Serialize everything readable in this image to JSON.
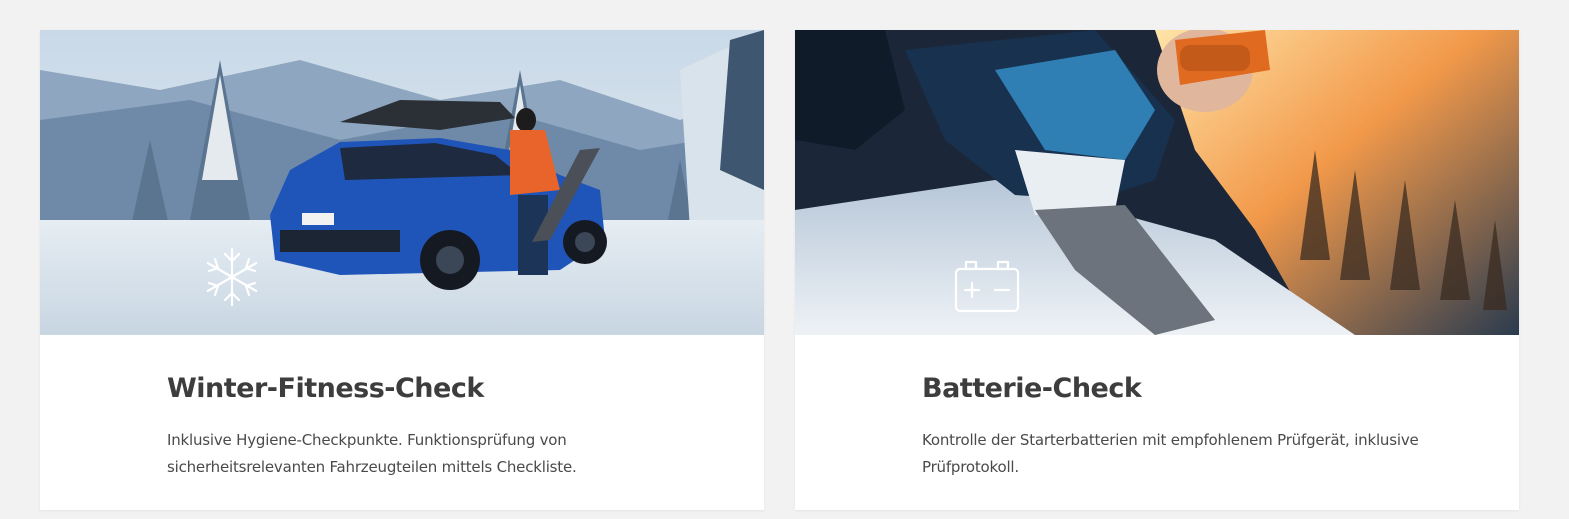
{
  "cards": [
    {
      "title": "Winter-Fitness-Check",
      "description": "Inklusive Hygiene-Checkpunkte. Funktionsprüfung von sicherheitsrelevanten Fahrzeugteilen mittels Checkliste.",
      "image": "snowy-mountain-car-scene",
      "icon": "snowflake-icon"
    },
    {
      "title": "Batterie-Check",
      "description": "Kontrolle der Starterbatterien mit empfohlenem Prüfgerät, inklusive Prüfprotokoll.",
      "image": "skier-selfie-scene",
      "icon": "battery-icon"
    }
  ],
  "colors": {
    "page_background": "#f2f2f2",
    "card_background": "#ffffff",
    "title_color": "#3d3d3d",
    "text_color": "#4a4a4a"
  }
}
